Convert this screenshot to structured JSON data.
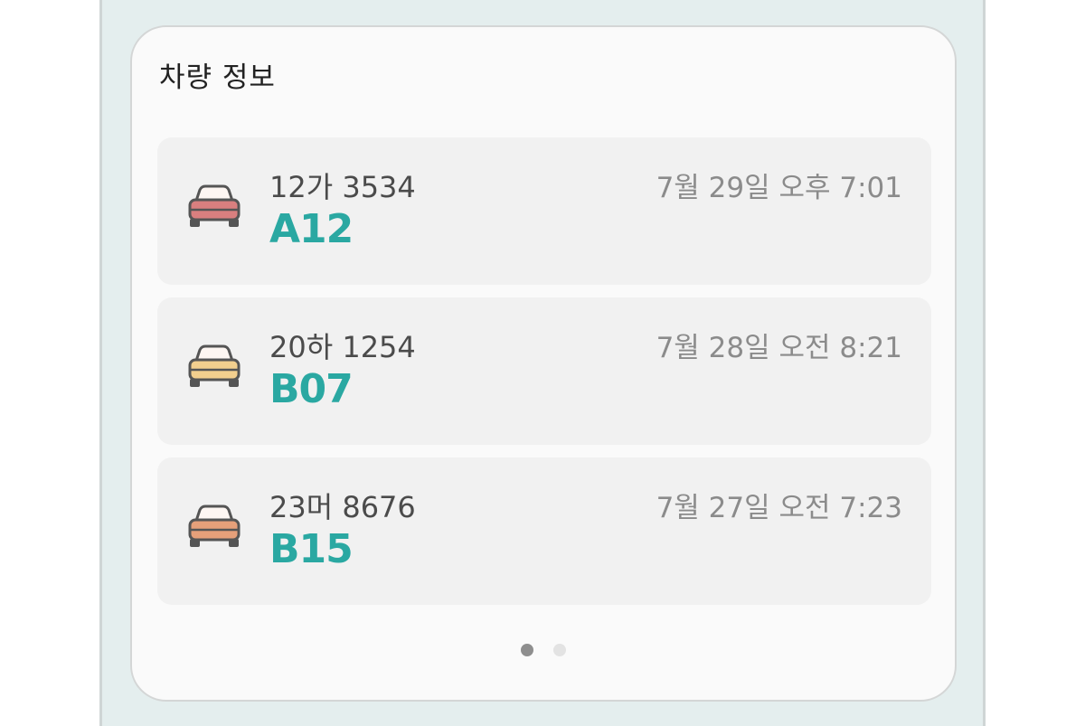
{
  "widget": {
    "title": "차량 정보"
  },
  "vehicles": [
    {
      "plate": "12가 3534",
      "spot": "A12",
      "time": "7월 29일 오후 7:01",
      "color": "#d97f7f",
      "icon": "car-icon"
    },
    {
      "plate": "20하 1254",
      "spot": "B07",
      "time": "7월 28일 오전 8:21",
      "color": "#f2cf8e",
      "icon": "car-icon"
    },
    {
      "plate": "23머 8676",
      "spot": "B15",
      "time": "7월 27일 오전 7:23",
      "color": "#e6a07a",
      "icon": "car-icon"
    }
  ],
  "pager": {
    "pages": 2,
    "active": 1
  },
  "colors": {
    "accent": "#2aa8a2",
    "background": "#e4eeee"
  }
}
